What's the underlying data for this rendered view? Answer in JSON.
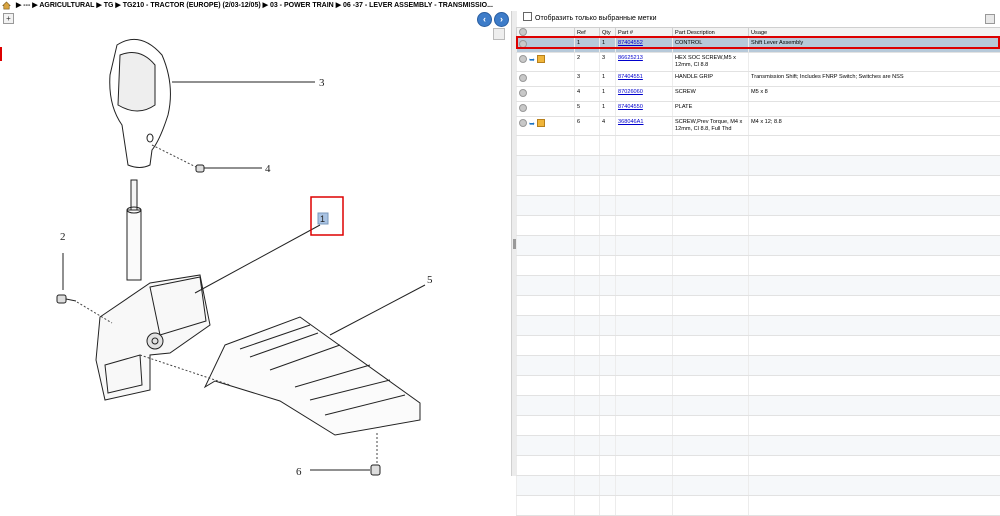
{
  "breadcrumb": {
    "items": [
      "---",
      "AGRICULTURAL",
      "TG",
      "TG210 - TRACTOR (EUROPE) (2/03-12/05)",
      "03 - POWER TRAIN",
      "06 -37 - LEVER ASSEMBLY - TRANSMISSIO..."
    ]
  },
  "diagram": {
    "callouts": [
      "1",
      "2",
      "3",
      "4",
      "5",
      "6"
    ]
  },
  "filter": {
    "label": "Отобразить только выбранные метки"
  },
  "table": {
    "headers": [
      "",
      "Ref",
      "Qty",
      "Part #",
      "Part Description",
      "Usage"
    ],
    "rows": [
      {
        "ref": "1",
        "qty": "1",
        "part": "87404552",
        "desc": "CONTROL",
        "usage": "Shift Lever Assembly"
      },
      {
        "ref": "2",
        "qty": "3",
        "part": "86625213",
        "desc": "HEX SOC SCREW,M5 x 12mm, Cl 8.8",
        "usage": ""
      },
      {
        "ref": "3",
        "qty": "1",
        "part": "87404551",
        "desc": "HANDLE GRIP",
        "usage": "Transmission Shift;  Includes FNRP Switch;  Switches are NSS"
      },
      {
        "ref": "4",
        "qty": "1",
        "part": "87026060",
        "desc": "SCREW",
        "usage": "M5 x 8"
      },
      {
        "ref": "5",
        "qty": "1",
        "part": "87404550",
        "desc": "PLATE",
        "usage": ""
      },
      {
        "ref": "6",
        "qty": "4",
        "part": "368046A1",
        "desc": "SCREW,Prev Torque, M4 x 12mm, Cl 8.8, Full Thd",
        "usage": "M4 x 12; 8.8"
      }
    ]
  },
  "colors": {
    "selected_row": "#b7c9d9",
    "highlight": "#dd0000",
    "link": "#0000cc"
  }
}
